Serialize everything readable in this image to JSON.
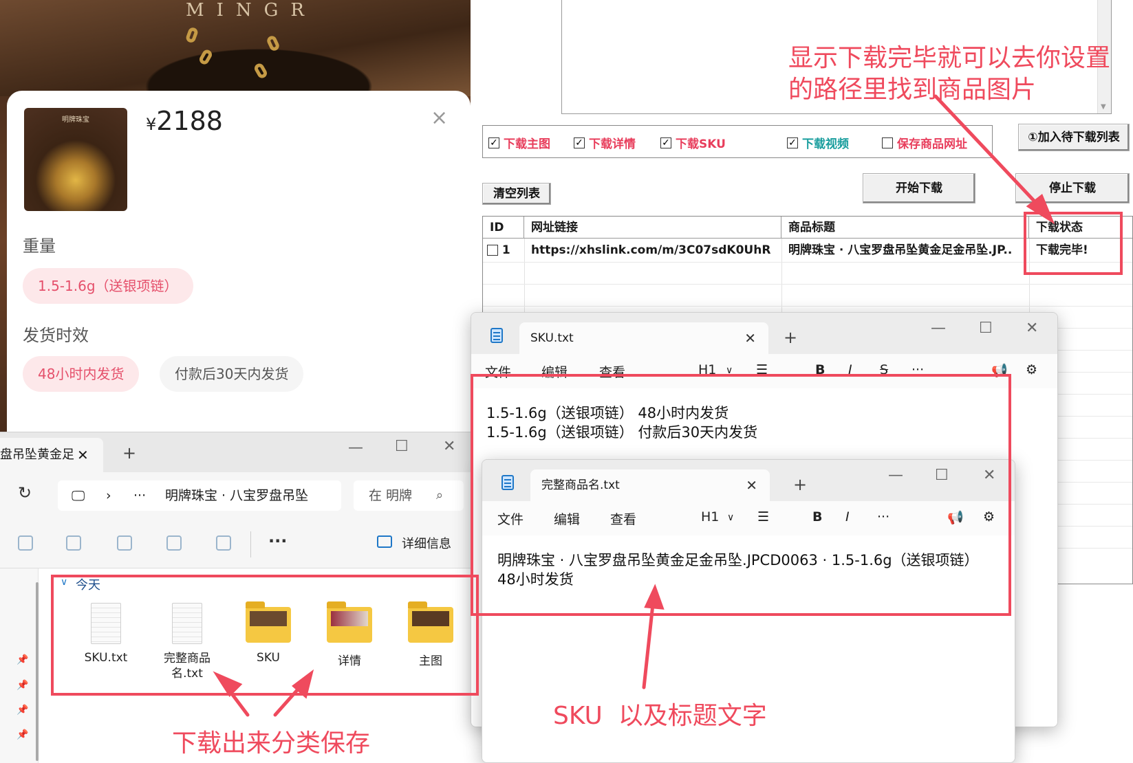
{
  "product": {
    "brand_word": "MINGR",
    "thumb_label": "明牌珠宝",
    "currency": "¥",
    "price": "2188",
    "close_glyph": "×",
    "weight_label": "重量",
    "weight_option": "1.5-1.6g（送银项链）",
    "ship_label": "发货时效",
    "ship_options": [
      "48小时内发货",
      "付款后30天内发货"
    ]
  },
  "downloader": {
    "options": [
      {
        "label": "下载主图",
        "checked": true,
        "color": "#e83e5c"
      },
      {
        "label": "下载详情",
        "checked": true,
        "color": "#e83e5c"
      },
      {
        "label": "下载SKU",
        "checked": true,
        "color": "#e83e5c"
      },
      {
        "label": "下载视频",
        "checked": true,
        "color": "#1a9e9e"
      },
      {
        "label": "保存商品网址",
        "checked": false,
        "color": "#e83e5c"
      }
    ],
    "add_button": "①加入待下载列表",
    "clear_button": "清空列表",
    "start_button": "开始下载",
    "stop_button": "停止下载",
    "table": {
      "headers": [
        "ID",
        "网址链接",
        "商品标题",
        "下载状态"
      ],
      "rows": [
        {
          "id": "1",
          "url": "https://xhslink.com/m/3C07sdK0UhR",
          "title": "明牌珠宝 · 八宝罗盘吊坠黄金足金吊坠.JP..",
          "status": "下载完毕!"
        }
      ]
    }
  },
  "notepad_sku": {
    "tab_title": "SKU.txt",
    "menus": [
      "文件",
      "编辑",
      "查看"
    ],
    "heading_menu": "H1",
    "lines": [
      "1.5-1.6g（送银项链） 48小时内发货",
      "1.5-1.6g（送银项链） 付款后30天内发货"
    ]
  },
  "notepad_title": {
    "tab_title": "完整商品名.txt",
    "menus": [
      "文件",
      "编辑",
      "查看"
    ],
    "heading_menu": "H1",
    "lines": [
      "明牌珠宝 · 八宝罗盘吊坠黄金足金吊坠.JPCD0063 · 1.5-1.6g（送银项链）",
      "48小时发货"
    ]
  },
  "explorer": {
    "tab_title": "盘吊坠黄金足",
    "path": "明牌珠宝 · 八宝罗盘吊坠",
    "search_placeholder": "在 明牌",
    "details_label": "详细信息",
    "group_label": "今天",
    "files": [
      {
        "name": "SKU.txt",
        "kind": "document"
      },
      {
        "name": "完整商品名.txt",
        "kind": "document"
      },
      {
        "name": "SKU",
        "kind": "folder"
      },
      {
        "name": "详情",
        "kind": "folder"
      },
      {
        "name": "主图",
        "kind": "folder"
      }
    ]
  },
  "annotations": {
    "top_right": "显示下载完毕就可以去你设置的路径里找到商品图片",
    "bottom_left": "下载出来分类保存",
    "bottom_mid": "SKU  以及标题文字"
  },
  "colors": {
    "annotation_red": "#ef4a5d",
    "pill_active_text": "#e5506b"
  }
}
